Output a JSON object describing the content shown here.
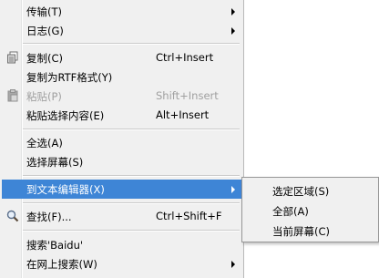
{
  "menu": {
    "items": [
      {
        "label": "传输(T)",
        "submenu": true
      },
      {
        "label": "日志(G)",
        "submenu": true
      },
      {
        "label": "复制(C)",
        "accel": "Ctrl+Insert",
        "icon": "copy-icon"
      },
      {
        "label": "复制为RTF格式(Y)"
      },
      {
        "label": "粘贴(P)",
        "accel": "Shift+Insert",
        "icon": "paste-icon",
        "disabled": true
      },
      {
        "label": "粘贴选择内容(E)",
        "accel": "Alt+Insert"
      },
      {
        "label": "全选(A)"
      },
      {
        "label": "选择屏幕(S)"
      },
      {
        "label": "到文本编辑器(X)",
        "submenu": true,
        "highlighted": true
      },
      {
        "label": "查找(F)...",
        "accel": "Ctrl+Shift+F",
        "icon": "search-icon"
      },
      {
        "label": "搜索'Baidu'"
      },
      {
        "label": "在网上搜索(W)",
        "submenu": true
      }
    ]
  },
  "submenu": {
    "items": [
      {
        "label": "选定区域(S)"
      },
      {
        "label": "全部(A)"
      },
      {
        "label": "当前屏幕(C)"
      }
    ]
  },
  "colors": {
    "menu_bg": "#f0f0f0",
    "highlight": "#3e85d6",
    "disabled_text": "#a0a0a0"
  }
}
